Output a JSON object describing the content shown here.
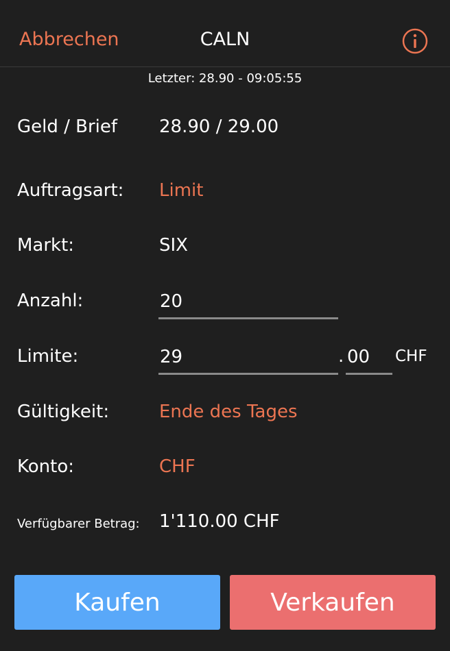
{
  "header": {
    "cancel_label": "Abbrechen",
    "title": "CALN",
    "info_icon": "info-circle-icon"
  },
  "last_trade": "Letzter: 28.90 - 09:05:55",
  "rows": {
    "bid_ask": {
      "label": "Geld / Brief",
      "value": "28.90 / 29.00"
    },
    "order_type": {
      "label": "Auftragsart:",
      "value": "Limit"
    },
    "market": {
      "label": "Markt:",
      "value": "SIX"
    },
    "quantity": {
      "label": "Anzahl:",
      "value": "20"
    },
    "limit": {
      "label": "Limite:",
      "value": "29",
      "decimal_sep": ".",
      "decimals": "00",
      "currency": "CHF"
    },
    "validity": {
      "label": "Gültigkeit:",
      "value": "Ende des Tages"
    },
    "account": {
      "label": "Konto:",
      "value": "CHF"
    },
    "available": {
      "label": "Verfügbarer Betrag:",
      "value": "1'110.00 CHF"
    }
  },
  "buttons": {
    "buy_label": "Kaufen",
    "sell_label": "Verkaufen"
  },
  "colors": {
    "accent": "#ec7552",
    "buy": "#59a8f9",
    "sell": "#eb6f6f",
    "background": "#1f1f1f"
  }
}
